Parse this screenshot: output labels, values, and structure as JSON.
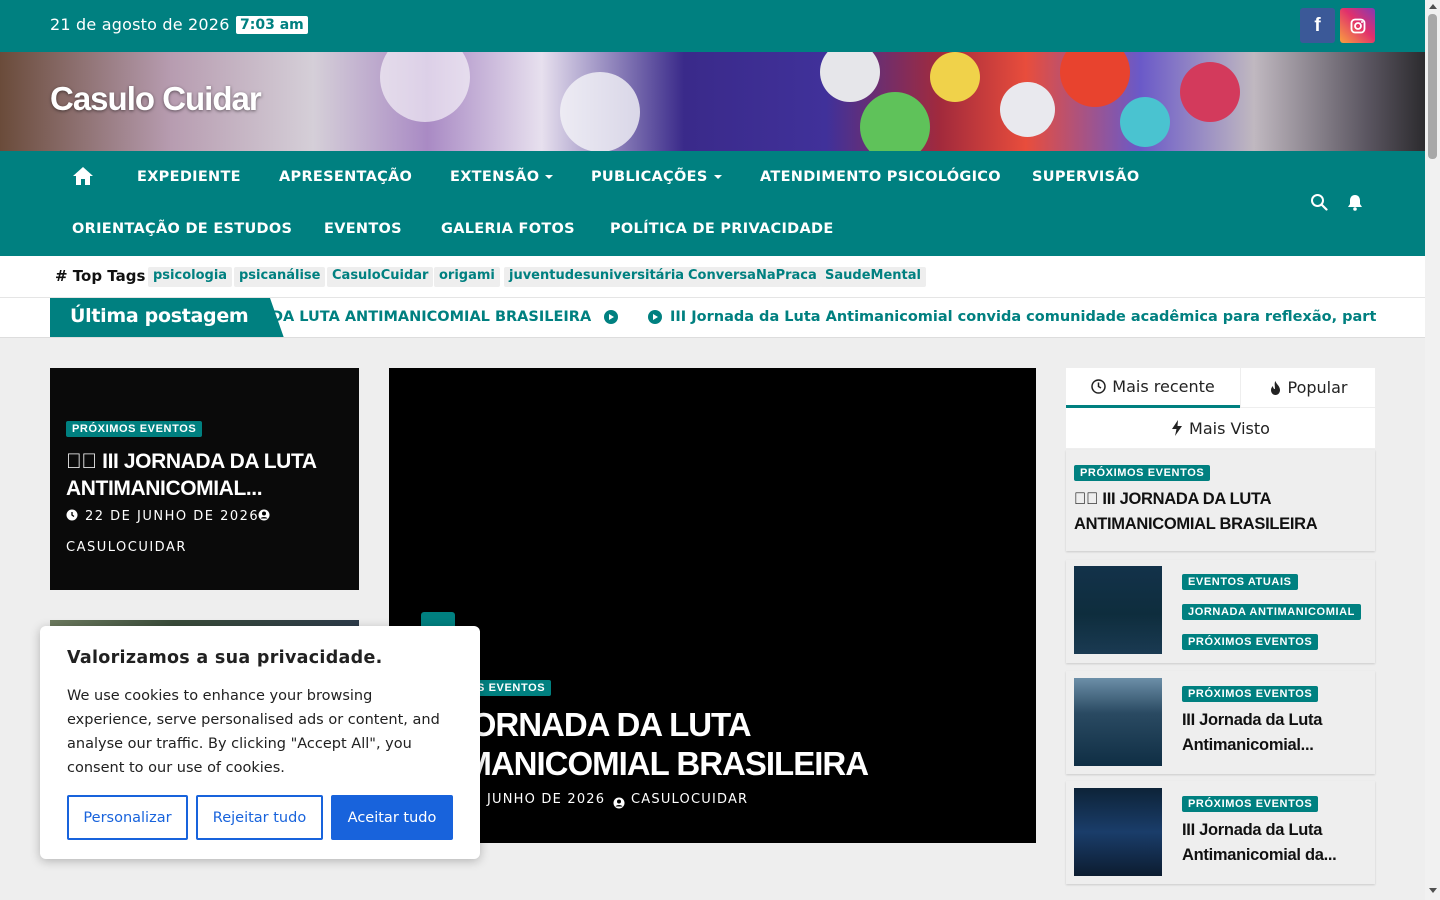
{
  "topbar": {
    "date": "21 de agosto de 2026",
    "time": "7:03 am",
    "facebook_icon": "f",
    "instagram_icon": "◎"
  },
  "site": {
    "title": "Casulo Cuidar"
  },
  "nav": {
    "items": [
      "EXPEDIENTE",
      "APRESENTAÇÃO",
      "EXTENSÃO",
      "PUBLICAÇÕES",
      "ATENDIMENTO PSICOLÓGICO",
      "SUPERVISÃO",
      "ORIENTAÇÃO DE ESTUDOS",
      "EVENTOS",
      "GALERIA FOTOS",
      "POLÍTICA DE PRIVACIDADE"
    ]
  },
  "tags": {
    "heading": "# Top Tags",
    "items": [
      "psicologia",
      "psicanálise",
      "CasuloCuidar",
      "origami",
      "juventudesuniversitária",
      "ConversaNaPraca",
      "SaudeMental"
    ]
  },
  "ticker": {
    "label": "Última postagem",
    "items": [
      "DA LUTA ANTIMANICOMIAL BRASILEIRA",
      "III Jornada da Luta Antimanicomial convida comunidade acadêmica para reflexão, particip"
    ]
  },
  "left_card": {
    "badge": "PRÓXIMOS EVENTOS",
    "title": "􏿾􏿾 III JORNADA DA LUTA ANTIMANICOMIAL...",
    "date": "22 DE JUNHO DE 2026",
    "author": "CASULOCUIDAR"
  },
  "featured": {
    "badge": "S EVENTOS",
    "title_line1": "I JORNADA DA LUTA",
    "title_line2": "TIMANICOMIAL BRASILEIRA",
    "date": "JUNHO DE 2026",
    "author": "CASULOCUIDAR"
  },
  "sidebar": {
    "tabs": [
      "Mais recente",
      "Popular",
      "Mais Visto"
    ],
    "top_post": {
      "badge": "PRÓXIMOS EVENTOS",
      "title": "􏿾􏿾 III JORNADA DA LUTA ANTIMANICOMIAL BRASILEIRA"
    },
    "posts": [
      {
        "badges": [
          "EVENTOS ATUAIS",
          "JORNADA ANTIMANICOMIAL",
          "PRÓXIMOS EVENTOS"
        ],
        "title": ""
      },
      {
        "badges": [
          "PRÓXIMOS EVENTOS"
        ],
        "title": "III Jornada da Luta Antimanicomial..."
      },
      {
        "badges": [
          "PRÓXIMOS EVENTOS"
        ],
        "title": "III Jornada da Luta Antimanicomial da..."
      }
    ]
  },
  "cookie": {
    "heading": "Valorizamos a sua privacidade.",
    "text": "We use cookies to enhance your browsing experience, serve personalised ads or content, and analyse our traffic. By clicking \"Accept All\", you consent to our use of cookies.",
    "customize": "Personalizar",
    "reject": "Rejeitar tudo",
    "accept": "Aceitar tudo"
  },
  "colors": {
    "primary": "#008080",
    "cookie_button": "#1863dc",
    "facebook": "#3b5998"
  }
}
